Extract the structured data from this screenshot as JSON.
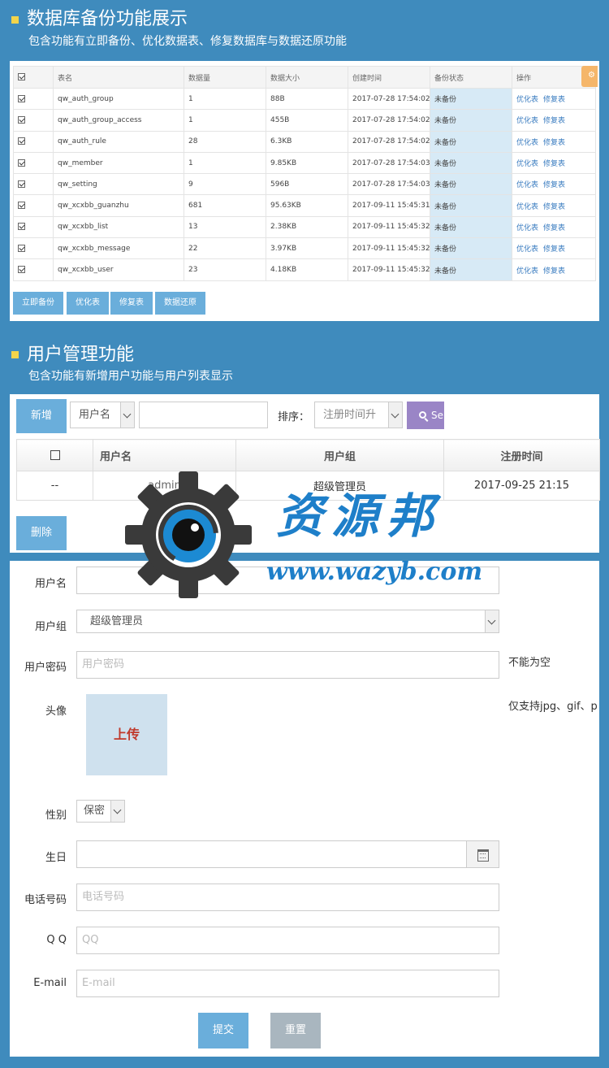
{
  "section1": {
    "title": "数据库备份功能展示",
    "subtitle": "包含功能有立即备份、优化数据表、修复数据库与数据还原功能"
  },
  "backup": {
    "headers": [
      "表名",
      "数据量",
      "数据大小",
      "创建时间",
      "备份状态",
      "操作"
    ],
    "rows": [
      {
        "name": "qw_auth_group",
        "count": "1",
        "size": "88B",
        "created": "2017-07-28 17:54:02",
        "status": "未备份"
      },
      {
        "name": "qw_auth_group_access",
        "count": "1",
        "size": "455B",
        "created": "2017-07-28 17:54:02",
        "status": "未备份"
      },
      {
        "name": "qw_auth_rule",
        "count": "28",
        "size": "6.3KB",
        "created": "2017-07-28 17:54:02",
        "status": "未备份"
      },
      {
        "name": "qw_member",
        "count": "1",
        "size": "9.85KB",
        "created": "2017-07-28 17:54:03",
        "status": "未备份"
      },
      {
        "name": "qw_setting",
        "count": "9",
        "size": "596B",
        "created": "2017-07-28 17:54:03",
        "status": "未备份"
      },
      {
        "name": "qw_xcxbb_guanzhu",
        "count": "681",
        "size": "95.63KB",
        "created": "2017-09-11 15:45:31",
        "status": "未备份"
      },
      {
        "name": "qw_xcxbb_list",
        "count": "13",
        "size": "2.38KB",
        "created": "2017-09-11 15:45:32",
        "status": "未备份"
      },
      {
        "name": "qw_xcxbb_message",
        "count": "22",
        "size": "3.97KB",
        "created": "2017-09-11 15:45:32",
        "status": "未备份"
      },
      {
        "name": "qw_xcxbb_user",
        "count": "23",
        "size": "4.18KB",
        "created": "2017-09-11 15:45:32",
        "status": "未备份"
      }
    ],
    "op_optimize": "优化表",
    "op_repair": "修复表",
    "buttons": {
      "backup_now": "立即备份",
      "optimize": "优化表",
      "repair": "修复表",
      "restore": "数据还原"
    }
  },
  "section2": {
    "title": "用户管理功能",
    "subtitle": "包含功能有新增用户功能与用户列表显示"
  },
  "users": {
    "add_label": "新增",
    "filter_field": "用户名",
    "sort_label": "排序：",
    "sort_value": "注册时间升",
    "search_label": "Se",
    "headers": [
      "用户名",
      "用户组",
      "注册时间"
    ],
    "row": {
      "id": "--",
      "username": "admin",
      "group": "超级管理员",
      "registered": "2017-09-25 21:15"
    },
    "delete_label": "删除"
  },
  "form": {
    "username_label": "用户名",
    "group_label": "用户组",
    "group_value": "超级管理员",
    "password_label": "用户密码",
    "password_placeholder": "用户密码",
    "password_hint": "不能为空",
    "avatar_label": "头像",
    "upload_label": "上传",
    "avatar_hint": "仅支持jpg、gif、p",
    "gender_label": "性别",
    "gender_value": "保密",
    "birthday_label": "生日",
    "phone_label": "电话号码",
    "phone_placeholder": "电话号码",
    "qq_label": "Q  Q",
    "qq_placeholder": "QQ",
    "email_label": "E-mail",
    "email_placeholder": "E-mail",
    "submit_label": "提交",
    "reset_label": "重置"
  },
  "watermark": {
    "name": "资源邦",
    "url": "www.wazyb.com"
  },
  "colors": {
    "background": "#3f8bbd",
    "accent": "#6aaedb",
    "search": "#9a85c6",
    "bullet": "#f3d44a"
  }
}
